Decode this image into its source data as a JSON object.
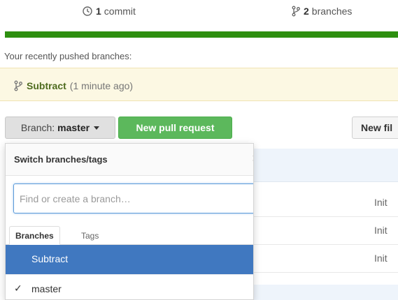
{
  "summary": {
    "commits_count": "1",
    "commits_label": "commit",
    "branches_count": "2",
    "branches_label": "branches",
    "commit_icon": "history-icon",
    "branch_icon": "git-branch-icon"
  },
  "recent": {
    "label": "Your recently pushed branches:",
    "branch_name": "Subtract",
    "time_ago": "(1 minute ago)"
  },
  "toolbar": {
    "branch_prefix": "Branch:",
    "branch_current": "master",
    "new_pr_label": "New pull request",
    "new_file_label": "New fil"
  },
  "files": {
    "row_texts": [
      "Init",
      "Init",
      "Init"
    ]
  },
  "dropdown": {
    "title": "Switch branches/tags",
    "close_glyph": "×",
    "search_placeholder": "Find or create a branch…",
    "tabs": [
      "Branches",
      "Tags"
    ],
    "items": [
      {
        "name": "Subtract",
        "selected": true
      },
      {
        "name": "master",
        "checked": true
      }
    ],
    "check_glyph": "✓"
  },
  "colors": {
    "progress_green": "#2e8f10",
    "pr_button": "#5cb85c",
    "selected_item": "#4078c0",
    "recent_bg": "#fcf8e3"
  }
}
